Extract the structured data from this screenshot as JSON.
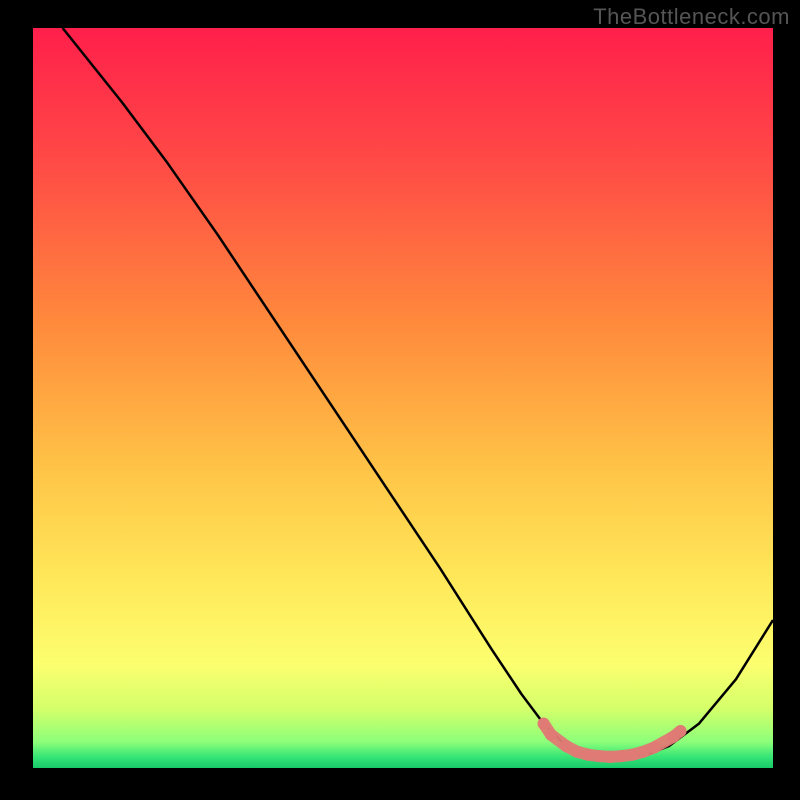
{
  "watermark": "TheBottleneck.com",
  "chart_data": {
    "type": "line",
    "title": "",
    "xlabel": "",
    "ylabel": "",
    "xlim": [
      0,
      100
    ],
    "ylim": [
      0,
      100
    ],
    "background_gradient": {
      "stops": [
        {
          "offset": 0.0,
          "color": "#ff1f4b"
        },
        {
          "offset": 0.18,
          "color": "#ff4a46"
        },
        {
          "offset": 0.4,
          "color": "#ff8a3c"
        },
        {
          "offset": 0.6,
          "color": "#ffc547"
        },
        {
          "offset": 0.75,
          "color": "#ffe95a"
        },
        {
          "offset": 0.86,
          "color": "#fcff6f"
        },
        {
          "offset": 0.92,
          "color": "#d4ff6a"
        },
        {
          "offset": 0.965,
          "color": "#8cff7a"
        },
        {
          "offset": 0.985,
          "color": "#35e576"
        },
        {
          "offset": 1.0,
          "color": "#18c96a"
        }
      ]
    },
    "series": [
      {
        "name": "curve",
        "color": "#000000",
        "x": [
          4,
          8,
          12,
          18,
          25,
          35,
          45,
          55,
          62,
          66,
          69,
          72,
          76,
          80,
          83,
          86,
          90,
          95,
          100
        ],
        "y": [
          100,
          95,
          90,
          82,
          72,
          57,
          42,
          27,
          16,
          10,
          6,
          3,
          1.5,
          1.5,
          1.8,
          3,
          6,
          12,
          20
        ]
      }
    ],
    "markers": {
      "name": "bottom-cluster",
      "color": "#e07a74",
      "points": [
        {
          "x": 69,
          "y": 6.0
        },
        {
          "x": 70,
          "y": 4.5
        },
        {
          "x": 72,
          "y": 3.0
        },
        {
          "x": 73.5,
          "y": 2.2
        },
        {
          "x": 75,
          "y": 1.8
        },
        {
          "x": 76.5,
          "y": 1.6
        },
        {
          "x": 78,
          "y": 1.5
        },
        {
          "x": 79.5,
          "y": 1.6
        },
        {
          "x": 81,
          "y": 1.8
        },
        {
          "x": 82.5,
          "y": 2.2
        },
        {
          "x": 84,
          "y": 2.8
        },
        {
          "x": 86.5,
          "y": 4.2
        },
        {
          "x": 87.5,
          "y": 5.0
        }
      ],
      "radius": 6
    }
  }
}
